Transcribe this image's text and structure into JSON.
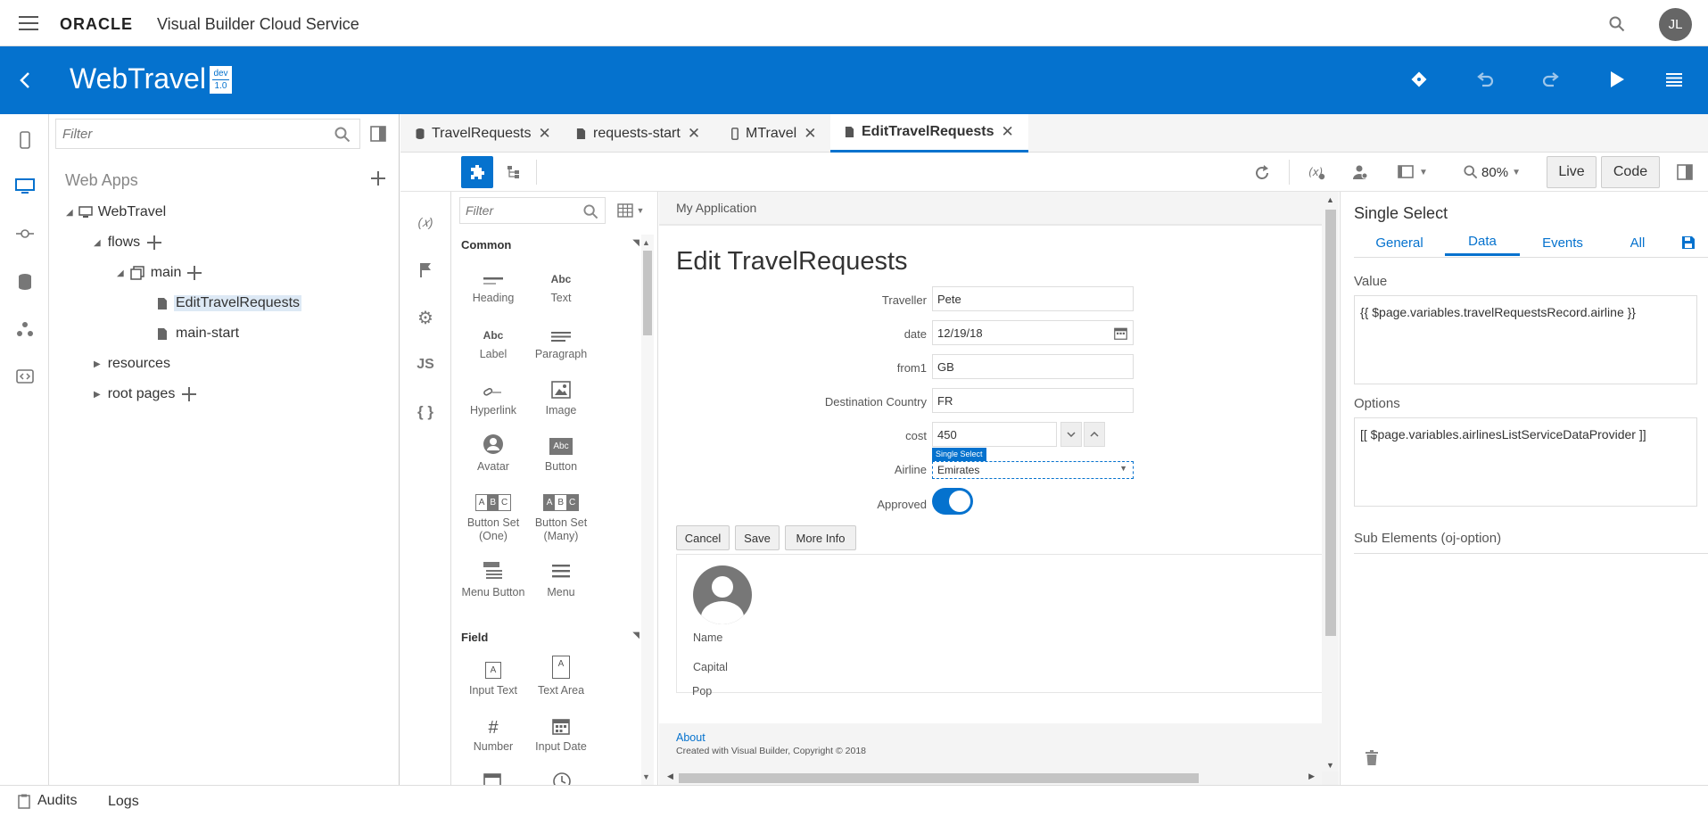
{
  "topbar": {
    "brand": "ORACLE",
    "product": "Visual Builder Cloud Service",
    "user_initials": "JL"
  },
  "appbar": {
    "title": "WebTravel",
    "badge_env": "dev",
    "badge_version": "1.0"
  },
  "navpane": {
    "filter_placeholder": "Filter",
    "section_title": "Web Apps",
    "tree": {
      "root": "WebTravel",
      "flows": "flows",
      "main": "main",
      "edit_page": "EditTravelRequests",
      "main_start": "main-start",
      "resources": "resources",
      "root_pages": "root pages"
    }
  },
  "tabs": [
    {
      "label": "TravelRequests"
    },
    {
      "label": "requests-start"
    },
    {
      "label": "MTravel"
    },
    {
      "label": "EditTravelRequests"
    }
  ],
  "toolbar": {
    "zoom": "80%",
    "live_label": "Live",
    "code_label": "Code"
  },
  "palette": {
    "filter_placeholder": "Filter",
    "common_title": "Common",
    "field_title": "Field",
    "common_items": [
      {
        "label": "Heading",
        "icon": "heading-icon"
      },
      {
        "label": "Text",
        "icon": "text-icon"
      },
      {
        "label": "Label",
        "icon": "label-icon"
      },
      {
        "label": "Paragraph",
        "icon": "paragraph-icon"
      },
      {
        "label": "Hyperlink",
        "icon": "hyperlink-icon"
      },
      {
        "label": "Image",
        "icon": "image-icon"
      },
      {
        "label": "Avatar",
        "icon": "avatar-icon"
      },
      {
        "label": "Button",
        "icon": "button-icon"
      },
      {
        "label": "Button Set (One)",
        "icon": "button-set-one-icon"
      },
      {
        "label": "Button Set (Many)",
        "icon": "button-set-many-icon"
      },
      {
        "label": "Menu Button",
        "icon": "menu-button-icon"
      },
      {
        "label": "Menu",
        "icon": "menu-icon"
      }
    ],
    "field_items": [
      {
        "label": "Input Text",
        "icon": "input-text-icon"
      },
      {
        "label": "Text Area",
        "icon": "text-area-icon"
      },
      {
        "label": "Number",
        "icon": "number-icon"
      },
      {
        "label": "Input Date",
        "icon": "input-date-icon"
      }
    ],
    "glyphs": {
      "abc": "Abc",
      "a": "A",
      "hash": "#"
    }
  },
  "canvas": {
    "app_header": "My Application",
    "page_title": "Edit TravelRequests",
    "form": {
      "traveller_label": "Traveller",
      "traveller_value": "Pete",
      "date_label": "date",
      "date_value": "12/19/18",
      "from_label": "from1",
      "from_value": "GB",
      "dest_label": "Destination Country",
      "dest_value": "FR",
      "cost_label": "cost",
      "cost_value": "450",
      "airline_label": "Airline",
      "airline_value": "Emirates",
      "select_tag": "Single Select",
      "approved_label": "Approved"
    },
    "buttons": {
      "cancel": "Cancel",
      "save": "Save",
      "more_info": "More Info"
    },
    "card": {
      "name": "Name",
      "capital": "Capital",
      "pop": "Pop"
    },
    "footer": {
      "about": "About",
      "copyright": "Created with Visual Builder, Copyright © 2018"
    }
  },
  "props": {
    "title": "Single Select",
    "tabs": [
      "General",
      "Data",
      "Events",
      "All"
    ],
    "active_tab": "Data",
    "value_label": "Value",
    "value_expr": "{{ $page.variables.travelRequestsRecord.airline }}",
    "options_label": "Options",
    "options_expr": "[[ $page.variables.airlinesListServiceDataProvider ]]",
    "sub_elements": "Sub Elements (oj-option)"
  },
  "bottombar": {
    "audits": "Audits",
    "logs": "Logs"
  },
  "colors": {
    "accent": "#0572ce",
    "toggle_on": "#0572ce"
  }
}
